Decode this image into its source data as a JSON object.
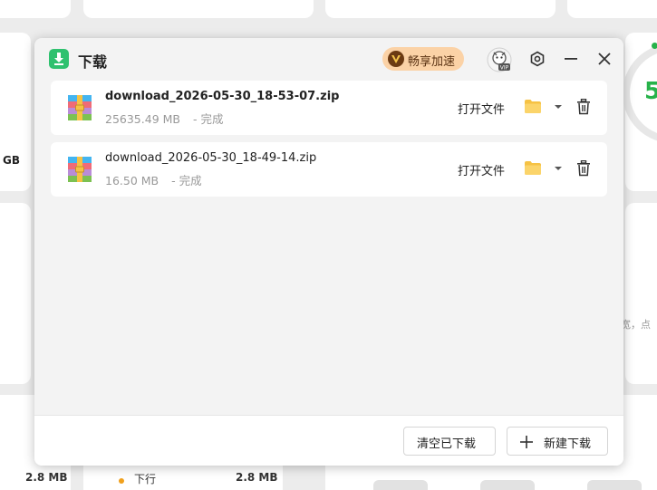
{
  "background": {
    "unit_gb": "GB",
    "right_number": "5",
    "side_text": "宽，点",
    "bottom_left_size": "2.8 MB",
    "bottom_mid_label": "下行",
    "bottom_mid_size": "2.8 MB"
  },
  "dialog": {
    "title": "下载",
    "vip_label": "畅享加速",
    "app_icon": "download-arrow-icon",
    "vip_icon": "vip-v-icon",
    "avatar_icon": "vip-avatar-icon",
    "settings_icon": "gear-icon",
    "minimize_icon": "minimize-icon",
    "close_icon": "close-icon"
  },
  "downloads": [
    {
      "filename": "download_2026-05-30_18-53-07.zip",
      "size": "25635.49 MB",
      "status": "- 完成",
      "open_label": "打开文件"
    },
    {
      "filename": "download_2026-05-30_18-49-14.zip",
      "size": "16.50 MB",
      "status": "- 完成",
      "open_label": "打开文件"
    }
  ],
  "footer": {
    "clear_label": "清空已下载",
    "new_label": "新建下载"
  },
  "colors": {
    "accent_green": "#2fc16f",
    "vip_bg": "#fbd2a6",
    "folder_yellow": "#f6c244"
  }
}
